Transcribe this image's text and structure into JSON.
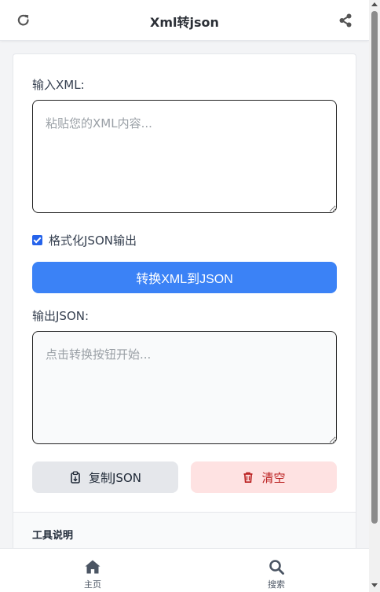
{
  "header": {
    "title": "Xml转json",
    "left_icon": "refresh-icon",
    "right_icon": "share-icon"
  },
  "input": {
    "label": "输入XML:",
    "placeholder": "粘贴您的XML内容...",
    "value": ""
  },
  "options": {
    "format_label": "格式化JSON输出",
    "format_checked": true
  },
  "convert_button": {
    "label": "转换XML到JSON"
  },
  "output": {
    "label": "输出JSON:",
    "placeholder": "点击转换按钮开始...",
    "value": ""
  },
  "actions": {
    "copy_label": "复制JSON",
    "copy_icon": "clipboard-icon",
    "clear_label": "清空",
    "clear_icon": "trash-icon"
  },
  "description": {
    "title": "工具说明"
  },
  "bottom_nav": {
    "items": [
      {
        "label": "主页",
        "icon": "home-icon"
      },
      {
        "label": "搜索",
        "icon": "search-icon"
      }
    ]
  },
  "colors": {
    "primary": "#3b82f6",
    "danger_bg": "#fee2e2",
    "danger_text": "#b91c1c",
    "neutral_button": "#e5e7eb"
  }
}
